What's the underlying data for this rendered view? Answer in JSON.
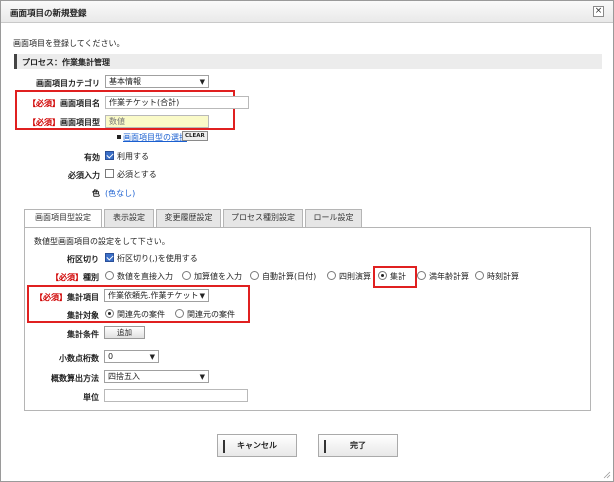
{
  "dialog": {
    "title": "画面項目の新規登録",
    "close_icon": "close-icon"
  },
  "intro": "画面項目を登録してください。",
  "process": "プロセス：作業集計管理",
  "form": {
    "category_label": "画面項目カテゴリ",
    "category_value": "基本情報",
    "required_tag": "【必須】",
    "name_label": "画面項目名",
    "name_value": "作業チケット(合計)",
    "type_label": "画面項目型",
    "type_value": "数値",
    "type_select_link": "画面項目型の選択",
    "clear_label": "CLEAR",
    "enabled_label": "有効",
    "enabled_text": "利用する",
    "enabled_checked": true,
    "required_label": "必須入力",
    "required_text": "必須とする",
    "required_checked": false,
    "color_label": "色",
    "color_value": "(色なし)"
  },
  "tabs": [
    "画面項目型設定",
    "表示設定",
    "変更履歴設定",
    "プロセス種別設定",
    "ロール設定"
  ],
  "panel": {
    "description": "数値型画面項目の設定をして下さい。",
    "separator_label": "桁区切り",
    "separator_text": "桁区切り(,)を使用する",
    "separator_checked": true,
    "kind_label": "種別",
    "kind_options": [
      "数値を直接入力",
      "加算値を入力",
      "自動計算(日付)",
      "四則演算",
      "集計",
      "満年齢計算",
      "時刻計算"
    ],
    "kind_selected": "集計",
    "agg_item_label": "集計項目",
    "agg_item_value": "作業依頼先.作業チケット",
    "agg_target_label": "集計対象",
    "agg_target_options": [
      "関連先の案件",
      "関連元の案件"
    ],
    "agg_target_selected": "関連先の案件",
    "agg_condition_label": "集計条件",
    "add_button": "追加",
    "decimals_label": "小数点桁数",
    "decimals_value": "0",
    "rounding_label": "概数算出方法",
    "rounding_value": "四捨五入",
    "unit_label": "単位",
    "unit_value": ""
  },
  "buttons": {
    "cancel": "キャンセル",
    "done": "完了"
  },
  "colors": {
    "required_red": "#d00000",
    "link_blue": "#1a5fd0",
    "highlight_box": "#e02020"
  }
}
